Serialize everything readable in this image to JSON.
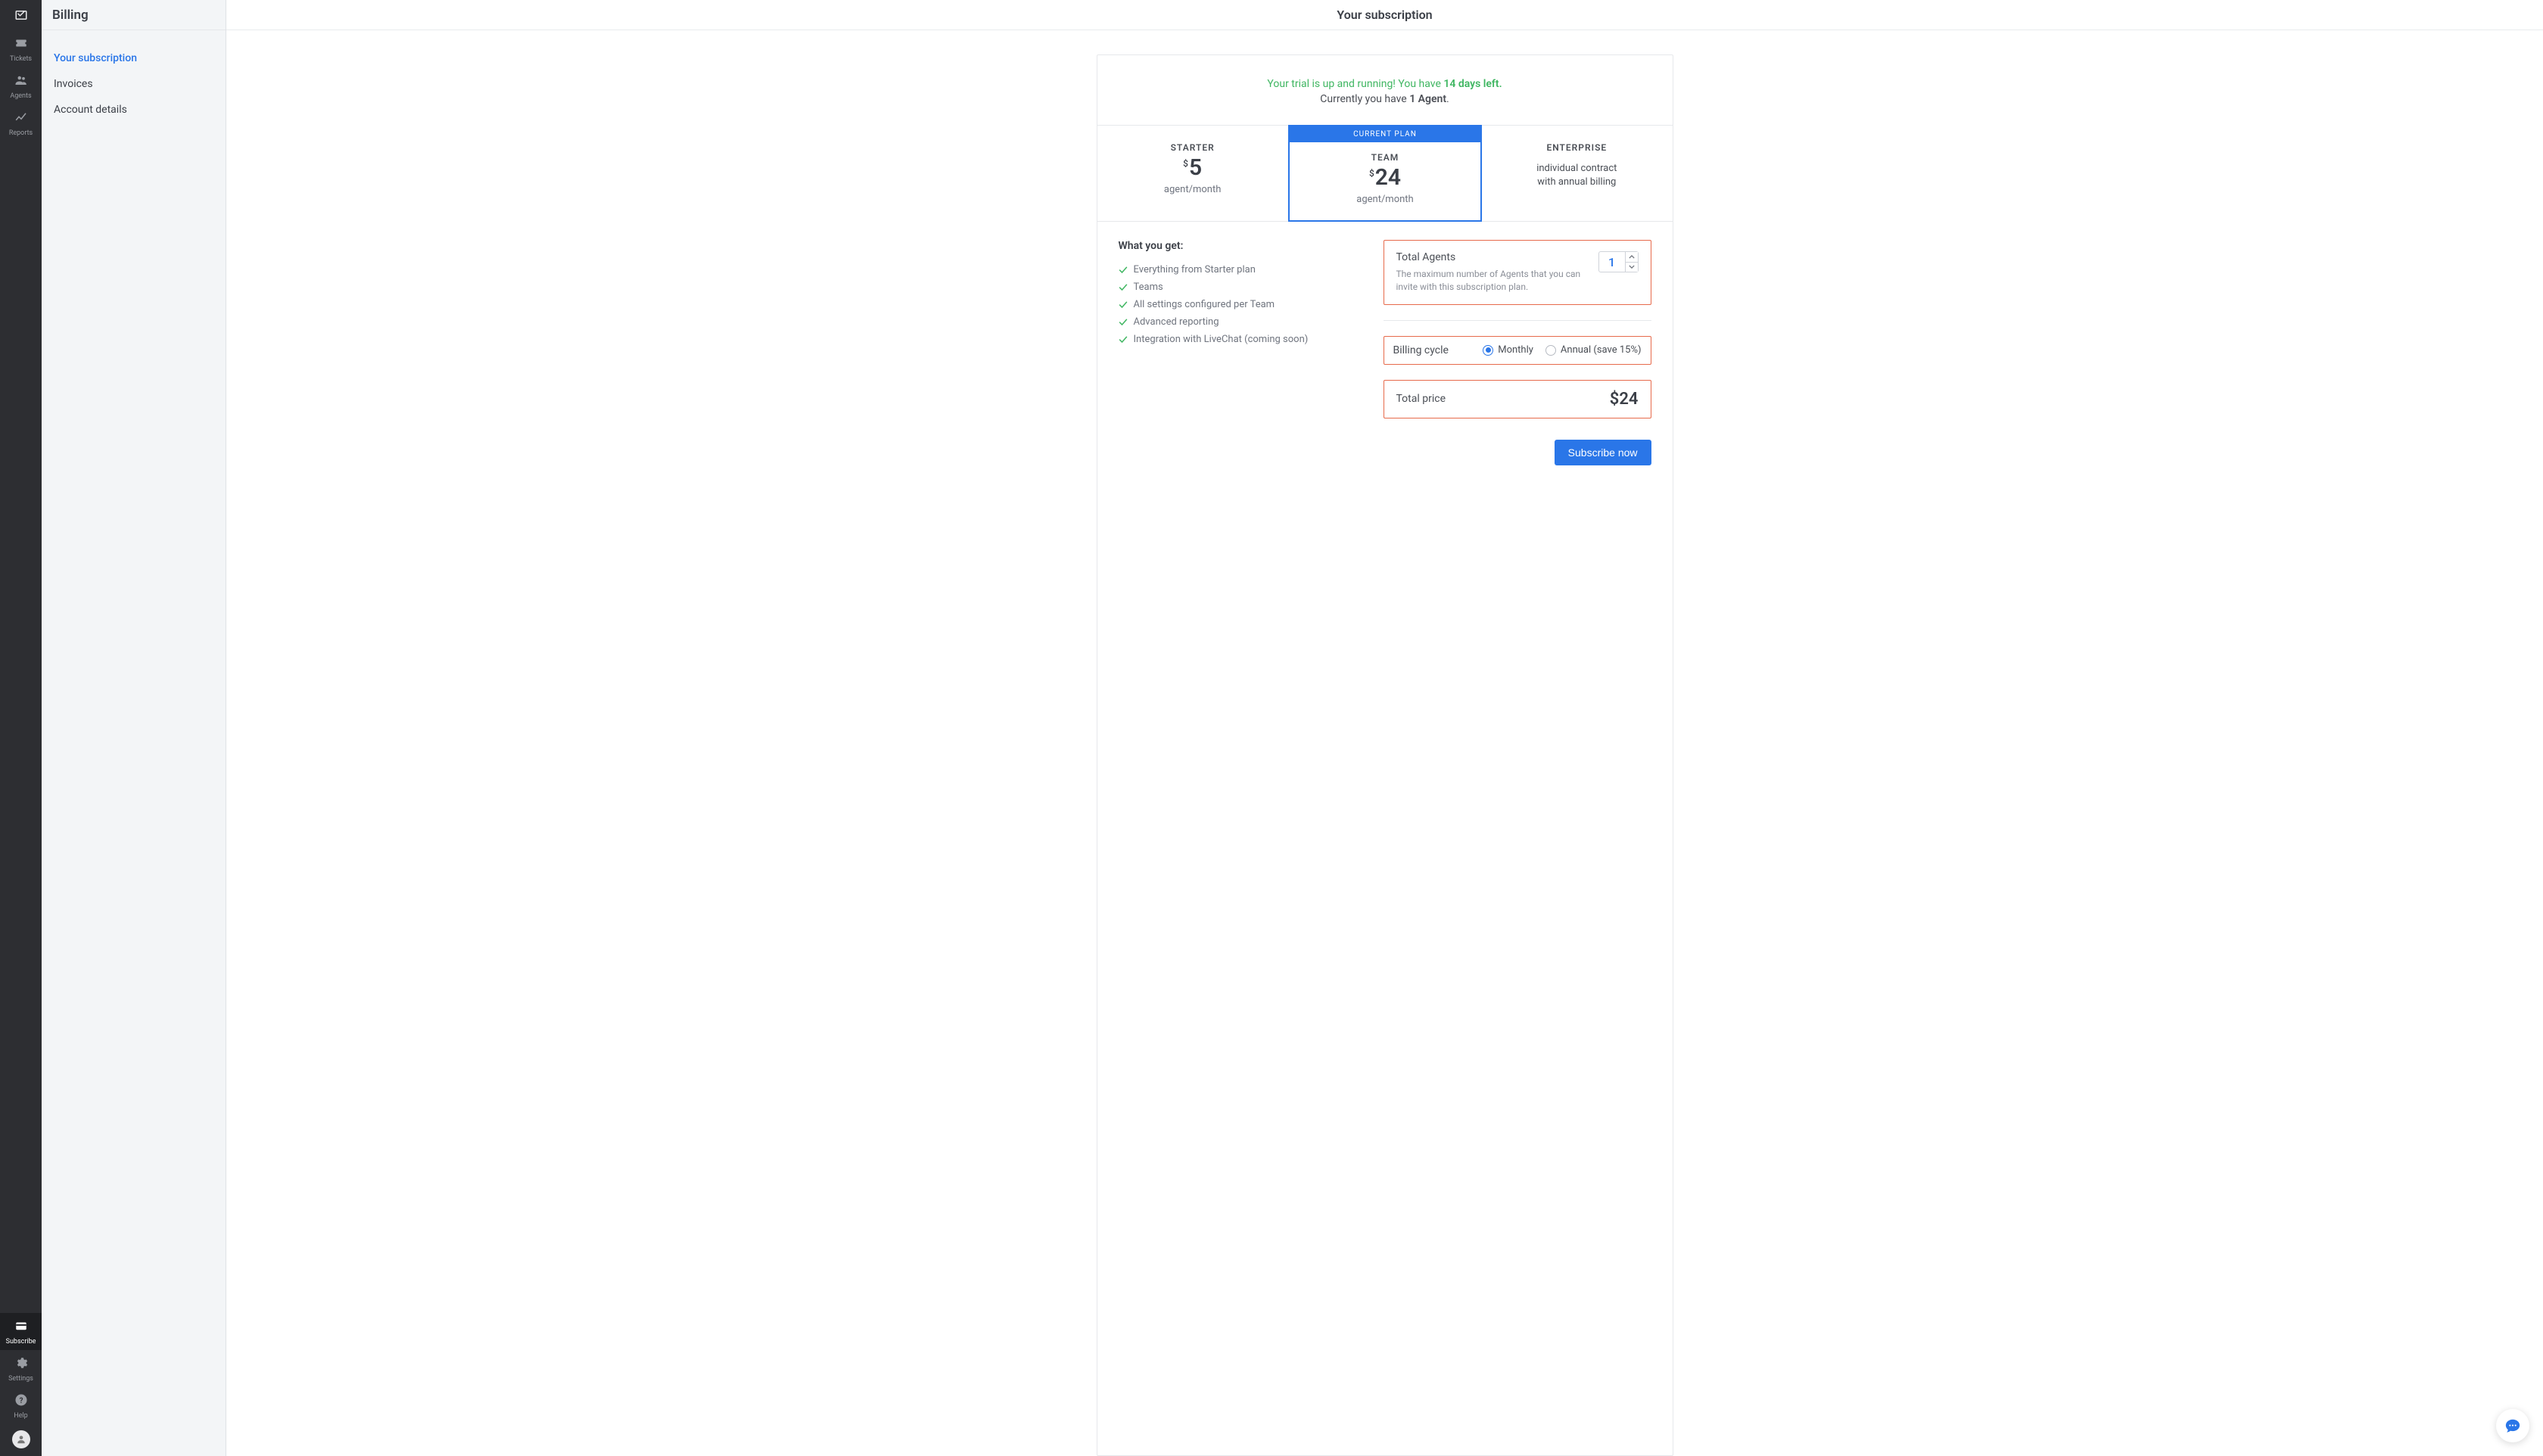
{
  "rail": {
    "items_top": [
      {
        "key": "tickets",
        "label": "Tickets"
      },
      {
        "key": "agents",
        "label": "Agents"
      },
      {
        "key": "reports",
        "label": "Reports"
      }
    ],
    "items_bottom": [
      {
        "key": "subscribe",
        "label": "Subscribe",
        "active": true
      },
      {
        "key": "settings",
        "label": "Settings"
      },
      {
        "key": "help",
        "label": "Help"
      }
    ]
  },
  "secondary": {
    "title": "Billing",
    "items": [
      {
        "label": "Your subscription",
        "active": true
      },
      {
        "label": "Invoices"
      },
      {
        "label": "Account details"
      }
    ]
  },
  "page": {
    "title": "Your subscription"
  },
  "trial": {
    "line1_prefix": "Your trial is up and running! You have ",
    "line1_days": "14 days left.",
    "line2_prefix": "Currently you have ",
    "line2_agents": "1 Agent",
    "line2_suffix": "."
  },
  "plans": {
    "current_badge": "CURRENT PLAN",
    "unit": "agent/month",
    "currency": "$",
    "list": [
      {
        "name": "STARTER",
        "price": "5",
        "type": "priced"
      },
      {
        "name": "TEAM",
        "price": "24",
        "type": "priced",
        "current": true
      },
      {
        "name": "ENTERPRISE",
        "type": "custom",
        "desc1": "individual contract",
        "desc2": "with annual billing"
      }
    ]
  },
  "features": {
    "heading": "What you get:",
    "items": [
      "Everything from Starter plan",
      "Teams",
      "All settings configured per Team",
      "Advanced reporting",
      "Integration with LiveChat (coming soon)"
    ]
  },
  "config": {
    "total_agents": {
      "label": "Total Agents",
      "sub": "The maximum number of Agents that you can invite with this subscription plan.",
      "value": "1"
    },
    "billing_cycle": {
      "label": "Billing cycle",
      "options": [
        {
          "label": "Monthly",
          "selected": true
        },
        {
          "label": "Annual (save 15%)",
          "selected": false
        }
      ]
    },
    "total_price": {
      "label": "Total price",
      "value": "$24"
    },
    "subscribe_btn": "Subscribe now"
  }
}
